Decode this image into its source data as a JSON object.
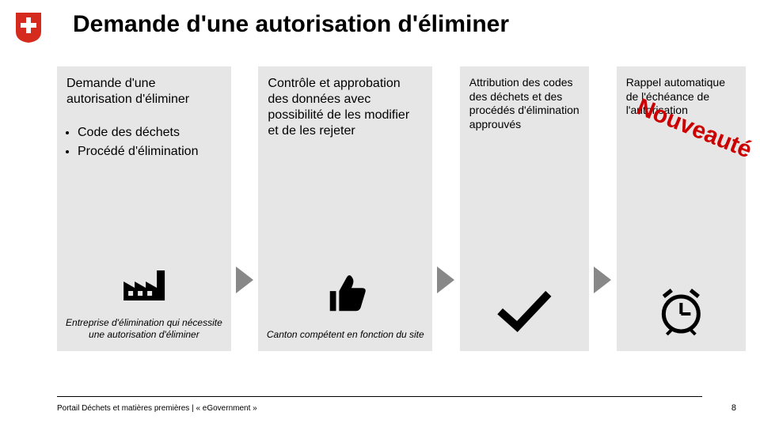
{
  "title": "Demande d'une autorisation d'éliminer",
  "badge": "Nouveauté",
  "columns": {
    "c1": {
      "heading": "Demande d'une autorisation d'éliminer",
      "bullets": [
        "Code des déchets",
        "Procédé d'élimination"
      ],
      "caption": "Entreprise d'élimination qui nécessite une autorisation d'éliminer"
    },
    "c2": {
      "text": "Contrôle et approbation des données avec possibilité de les modifier et de les rejeter",
      "caption": "Canton compétent en fonction du site"
    },
    "c3": {
      "text": "Attribution des codes des déchets et des procédés d'élimination approuvés"
    },
    "c4": {
      "text": "Rappel automatique de l'échéance de l'autorisation"
    }
  },
  "footer": "Portail Déchets et matières premières | « eGovernment »",
  "page": "8",
  "icons": {
    "logo": "swiss-shield",
    "c1": "factory-icon",
    "c2": "thumbs-up-icon",
    "c3": "checkmark-icon",
    "c4": "alarm-clock-icon"
  },
  "colors": {
    "accent": "#cc0000",
    "panel": "#e6e6e6"
  }
}
